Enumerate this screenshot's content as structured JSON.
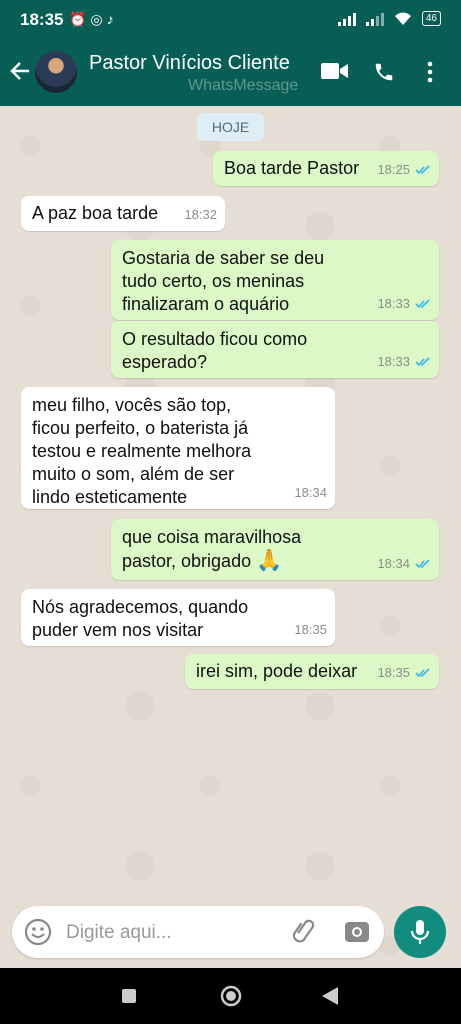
{
  "status_bar": {
    "time": "18:35",
    "battery": "46"
  },
  "header": {
    "contact_name": "Pastor Vinícios Cliente",
    "watermark": "WhatsMessage"
  },
  "chat": {
    "date_chip": "HOJE",
    "messages": [
      {
        "direction": "out",
        "text": "Boa tarde Pastor",
        "time": "18:25",
        "status": "read"
      },
      {
        "direction": "in",
        "text": "A paz boa tarde",
        "time": "18:32"
      },
      {
        "direction": "out",
        "text": "Gostaria de saber se deu\ntudo certo, os meninas\nfinalizaram o aquário",
        "time": "18:33",
        "status": "read"
      },
      {
        "direction": "out",
        "text": "O resultado ficou como\nesperado?",
        "time": "18:33",
        "status": "read"
      },
      {
        "direction": "in",
        "text": "meu filho, vocês são top,\nficou perfeito, o baterista já\ntestou e realmente melhora\nmuito o som, além de ser\nlindo esteticamente",
        "time": "18:34"
      },
      {
        "direction": "out",
        "text": "que coisa maravilhosa\npastor, obrigado",
        "emoji": "🙏",
        "time": "18:34",
        "status": "read"
      },
      {
        "direction": "in",
        "text": "Nós agradecemos, quando\npuder vem nos visitar",
        "time": "18:35"
      },
      {
        "direction": "out",
        "text": "irei sim, pode deixar",
        "time": "18:35",
        "status": "read"
      }
    ]
  },
  "composer": {
    "placeholder": "Digite aqui..."
  },
  "colors": {
    "header": "#075e54",
    "outgoing_bubble": "#dcf8c6",
    "incoming_bubble": "#ffffff",
    "read_ticks": "#34b7f1",
    "mic_button": "#128c7e"
  },
  "icons": [
    "back-arrow-icon",
    "video-call-icon",
    "phone-icon",
    "more-options-icon",
    "emoji-icon",
    "attach-icon",
    "camera-icon",
    "mic-icon"
  ]
}
